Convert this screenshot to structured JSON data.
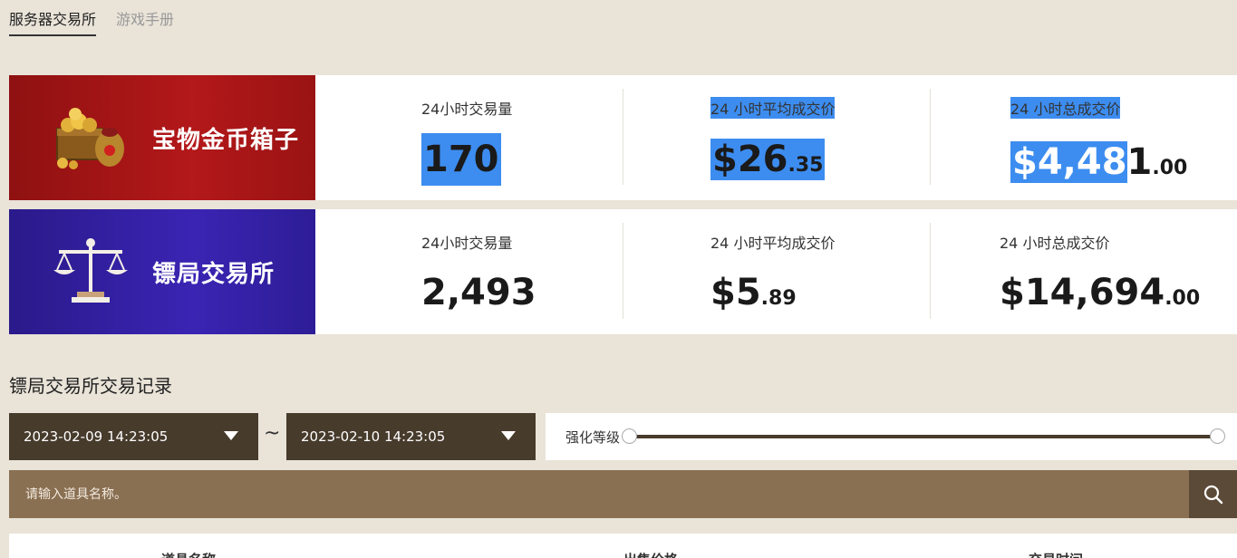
{
  "tabs": [
    {
      "label": "服务器交易所",
      "active": true
    },
    {
      "label": "游戏手册",
      "active": false
    }
  ],
  "stats_rows": [
    {
      "name": "宝物金币箱子",
      "icon": "treasure-chest-icon",
      "volume_label": "24小时交易量",
      "volume": "170",
      "avg_label": "24 小时平均成交价",
      "avg_main": "$26",
      "avg_dec": ".35",
      "total_label": "24 小时总成交价",
      "total_main_hl": "$4,48",
      "total_main_rest": "1",
      "total_dec": ".00"
    },
    {
      "name": "镖局交易所",
      "icon": "scales-icon",
      "volume_label": "24小时交易量",
      "volume": "2,493",
      "avg_label": "24 小时平均成交价",
      "avg_main": "$5",
      "avg_dec": ".89",
      "total_label": "24 小时总成交价",
      "total_main": "$14,694",
      "total_dec": ".00"
    }
  ],
  "section_title": "镖局交易所交易记录",
  "filters": {
    "start_date": "2023-02-09 14:23:05",
    "end_date": "2023-02-10 14:23:05",
    "separator": "~",
    "level_label": "强化等级"
  },
  "search": {
    "placeholder": "请输入道具名称。",
    "icon": "search-icon"
  },
  "table_headers": [
    "道具名称",
    "出售价格",
    "交易时间"
  ],
  "colors": {
    "background": "#e9e3d8",
    "red_banner": "#b3181a",
    "blue_banner": "#3a24b3",
    "dark_brown": "#473b2c",
    "search_brown": "#8a7053",
    "highlight": "#3d8df0"
  }
}
